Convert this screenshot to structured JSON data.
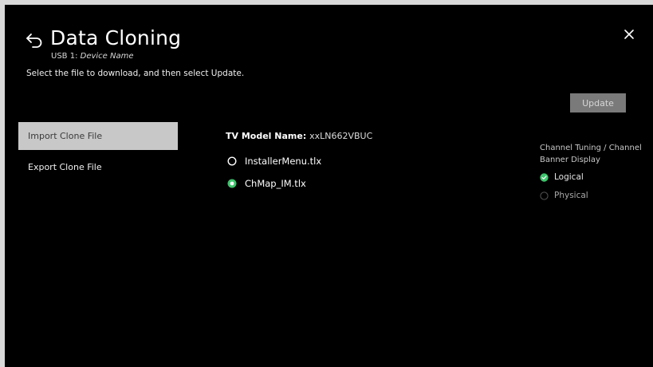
{
  "header": {
    "title": "Data Cloning",
    "subtitle_prefix": "USB 1: ",
    "subtitle_device": "Device Name",
    "instructions": "Select the file to download, and then select Update."
  },
  "icons": {
    "back": "back-arrow-icon",
    "close": "close-icon"
  },
  "actions": {
    "update_label": "Update"
  },
  "menu": {
    "items": [
      {
        "label": "Import Clone File",
        "selected": true
      },
      {
        "label": "Export Clone File",
        "selected": false
      }
    ]
  },
  "files": {
    "model_label": "TV Model Name: ",
    "model_value": "xxLN662VBUC",
    "items": [
      {
        "name": "InstallerMenu.tlx",
        "selected": false
      },
      {
        "name": "ChMap_IM.tlx",
        "selected": true
      }
    ]
  },
  "channel_display": {
    "heading": "Channel Tuning / Channel Banner Display",
    "options": [
      {
        "label": "Logical",
        "selected": true
      },
      {
        "label": "Physical",
        "selected": false
      }
    ]
  },
  "colors": {
    "background": "#000000",
    "selected_menu_bg": "#c8c8c8",
    "accent_green": "#3ec46d",
    "update_button_bg": "#7a7a7a"
  }
}
